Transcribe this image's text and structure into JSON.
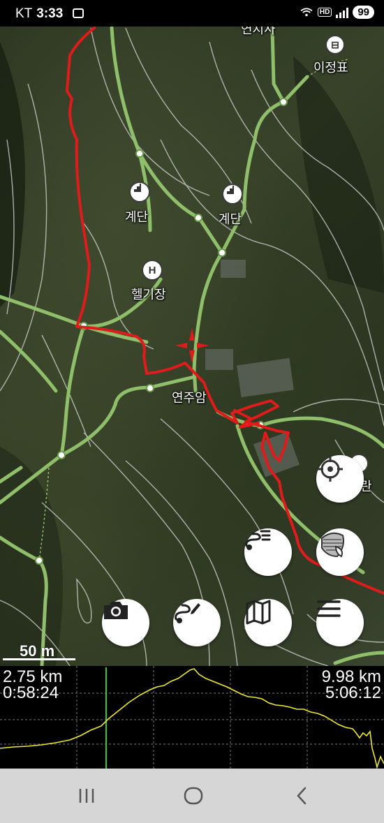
{
  "status_bar": {
    "carrier": "KT",
    "time": "3:33",
    "hd": "HD",
    "battery": "99"
  },
  "map": {
    "labels": {
      "top_road": "연지사",
      "place_top_right": "이정표",
      "stairs_left": "계단",
      "stairs_right": "계단",
      "helipad": "헬기장",
      "temple": "연주암",
      "right_edge": "란"
    },
    "poi_letters": {
      "helipad": "H"
    },
    "scale_label": "50 m",
    "colors": {
      "track": "#e01b1b",
      "trail": "#8fbf6a",
      "contour": "#d8d8d8"
    }
  },
  "buttons": {
    "locate": "crosshair-icon",
    "route": "route-list-icon",
    "layers": "layers-icon",
    "camera": "camera-icon",
    "draw_route": "draw-route-icon",
    "map": "map-icon",
    "menu": "menu-icon"
  },
  "profile": {
    "current_distance": "2.75 km",
    "current_time": "0:58:24",
    "total_distance": "9.98 km",
    "total_time": "5:06:12",
    "line_color": "#f2ea2a",
    "cursor_color": "#2ecc2e"
  },
  "nav_bar": {
    "recents": "recents-icon",
    "home": "home-icon",
    "back": "back-icon"
  }
}
